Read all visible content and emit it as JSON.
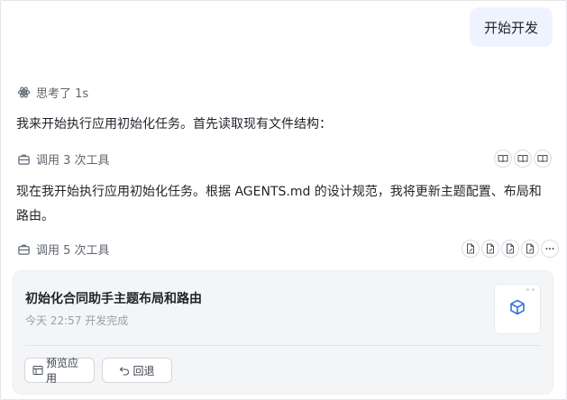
{
  "user_message": "开始开发",
  "thinking": {
    "label": "思考了 1s"
  },
  "paragraph_1": "我来开始执行应用初始化任务。首先读取现有文件结构：",
  "tool_call_1": {
    "label": "调用 3 次工具",
    "icons": [
      "book-icon",
      "book-icon",
      "book-icon"
    ]
  },
  "paragraph_2": "现在我开始执行应用初始化任务。根据 AGENTS.md 的设计规范，我将更新主题配置、布局和路由。",
  "tool_call_2": {
    "label": "调用 5 次工具",
    "icons": [
      "file-edit-icon",
      "file-edit-icon",
      "file-edit-icon",
      "file-edit-icon",
      "more-icon"
    ]
  },
  "result_card": {
    "title": "初始化合同助手主题布局和路由",
    "subtitle": "今天 22:57 开发完成",
    "preview_label": "预览应用",
    "revert_label": "回退",
    "thumbnail_icon": "cube-icon"
  },
  "colors": {
    "user_bubble_bg": "#eef3ff",
    "accent": "#3a6fe0",
    "card_bg": "#f4f5f7"
  }
}
